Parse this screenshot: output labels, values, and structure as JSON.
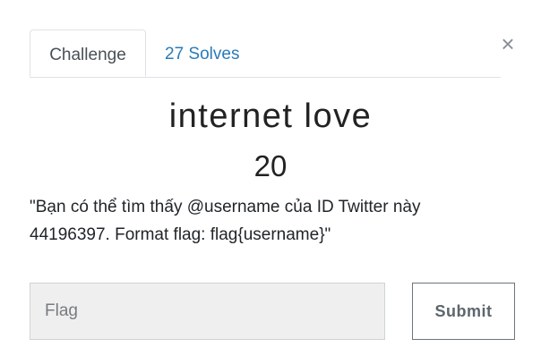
{
  "tabs": {
    "challenge_label": "Challenge",
    "solves_label": "27 Solves"
  },
  "close_symbol": "×",
  "challenge": {
    "title": "internet love",
    "points": "20",
    "description_line1": "\"Bạn có thể tìm thấy @username của ID Twitter này",
    "description_line2": "44196397. Format flag: flag{username}\""
  },
  "form": {
    "flag_placeholder": "Flag",
    "flag_value": "",
    "submit_label": "Submit"
  },
  "colors": {
    "link": "#2a7bb8",
    "input_bg": "#efefef",
    "button_border": "#6c757d"
  }
}
